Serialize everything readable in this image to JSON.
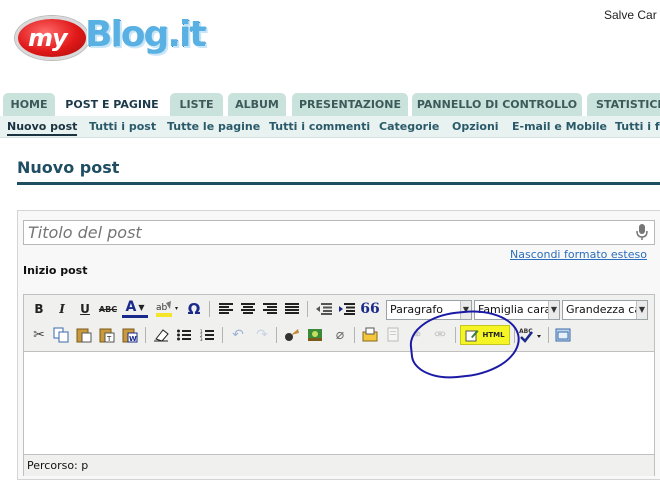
{
  "header": {
    "logo_text_my": "my",
    "logo_text_blog": "Blog.it",
    "greeting": "Salve Car"
  },
  "main_nav": {
    "tabs": [
      {
        "label": "HOME"
      },
      {
        "label": "POST E PAGINE",
        "active": true
      },
      {
        "label": "LISTE"
      },
      {
        "label": "ALBUM"
      },
      {
        "label": "PRESENTAZIONE"
      },
      {
        "label": "PANNELLO DI CONTROLLO"
      },
      {
        "label": "STATISTICH"
      }
    ]
  },
  "sub_nav": {
    "items": [
      {
        "label": "Nuovo post",
        "active": true
      },
      {
        "label": "Tutti i post"
      },
      {
        "label": "Tutte le pagine"
      },
      {
        "label": "Tutti i commenti"
      },
      {
        "label": "Categorie"
      },
      {
        "label": "Opzioni"
      },
      {
        "label": "E-mail e Mobile"
      },
      {
        "label": "Tutti i fe"
      }
    ]
  },
  "page": {
    "title": "Nuovo post"
  },
  "editor": {
    "title_placeholder": "Titolo del post",
    "hide_format_link": "Nascondi formato esteso",
    "start_label": "Inizio post",
    "format_select": "Paragrafo",
    "font_family_select": "Famiglia caratt",
    "font_size_select": "Grandezza cara",
    "html_button_label": "HTML",
    "bold": "B",
    "italic": "I",
    "underline": "U",
    "strike": "ABC",
    "font_color": "A",
    "omega": "Ω",
    "quote": "66",
    "spellcheck_label": "ABC",
    "status_bar": "Percorso: p"
  },
  "colors": {
    "tab_bg": "#c9e2dc",
    "subnav_bg": "#e8f2f0",
    "title_color": "#1f4e63",
    "link_color": "#2a6ebb",
    "highlight_circle": "#1a1aa6",
    "html_button_bg": "#f5f526"
  },
  "icons": [
    "microphone-icon",
    "bold-icon",
    "italic-icon",
    "underline-icon",
    "strikethrough-icon",
    "font-color-icon",
    "highlight-color-icon",
    "omega-icon",
    "align-left-icon",
    "align-center-icon",
    "align-right-icon",
    "align-justify-icon",
    "outdent-icon",
    "indent-icon",
    "blockquote-icon",
    "cut-icon",
    "copy-icon",
    "paste-icon",
    "paste-text-icon",
    "paste-word-icon",
    "eraser-icon",
    "bullet-list-icon",
    "numbered-list-icon",
    "undo-icon",
    "redo-icon",
    "image-icon",
    "media-icon",
    "attach-icon",
    "insert-snippet-icon",
    "template-icon",
    "link-icon",
    "unlink-icon",
    "html-edit-icon",
    "spellcheck-icon",
    "fullscreen-icon"
  ]
}
